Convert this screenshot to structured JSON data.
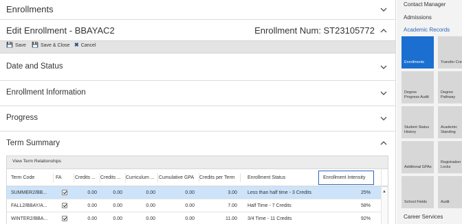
{
  "enrollments_header": {
    "title": "Enrollments"
  },
  "edit_header": {
    "title": "Edit Enrollment - BBAYAC2",
    "enrollment_num": "Enrollment Num: ST23105772"
  },
  "toolbar": {
    "save": "Save",
    "save_close": "Save & Close",
    "cancel": "Cancel"
  },
  "sections": {
    "date_status": "Date and Status",
    "enrollment_info": "Enrollment Information",
    "progress": "Progress",
    "term_summary": "Term Summary"
  },
  "grid": {
    "toolbar_label": "View Term Relationships",
    "columns": [
      "Term Code",
      "FA",
      "Credits ...",
      "Credits ...",
      "Curriculum ...",
      "Cumulative GPA",
      "Credits per Term",
      "Enrollment Status",
      "Enrollment Intensity"
    ],
    "rows": [
      {
        "term": "SUMMER2/BB...",
        "fa": true,
        "c1": "0.00",
        "c2": "0.00",
        "curr": "0.00",
        "gpa": "0.00",
        "cpt": "3.00",
        "status": "Less than half time - 3 Credits",
        "intensity": "25%",
        "selected": true
      },
      {
        "term": "FALL2/BBAY/A...",
        "fa": true,
        "c1": "0.00",
        "c2": "0.00",
        "curr": "0.00",
        "gpa": "0.00",
        "cpt": "7.00",
        "status": "Half Time - 7 Credits",
        "intensity": "58%",
        "selected": false
      },
      {
        "term": "WINTER2/BBA...",
        "fa": true,
        "c1": "0.00",
        "c2": "0.00",
        "curr": "0.00",
        "gpa": "0.00",
        "cpt": "11.00",
        "status": "3/4 Time - 11 Credits",
        "intensity": "92%",
        "selected": false
      }
    ]
  },
  "sidebar": {
    "links": {
      "contact_manager": "Contact Manager",
      "admissions": "Admissions",
      "academic_records": "Academic Records",
      "career_services": "Career Services"
    },
    "tiles": [
      {
        "label": "Enrollments",
        "active": true
      },
      {
        "label": "Transfer Credits",
        "active": false
      },
      {
        "label": "Degree Progress Audit",
        "active": false
      },
      {
        "label": "Degree Pathway",
        "active": false
      },
      {
        "label": "Student Status History",
        "active": false
      },
      {
        "label": "Academic Standing",
        "active": false
      },
      {
        "label": "Additional GPAs",
        "active": false
      },
      {
        "label": "Registration Locks",
        "active": false
      },
      {
        "label": "School Fields",
        "active": false
      },
      {
        "label": "Audit",
        "active": false
      }
    ]
  },
  "colors": {
    "accent": "#2a65b8",
    "tile_active": "#1b6fd0",
    "selected_row": "#cce3f9"
  }
}
